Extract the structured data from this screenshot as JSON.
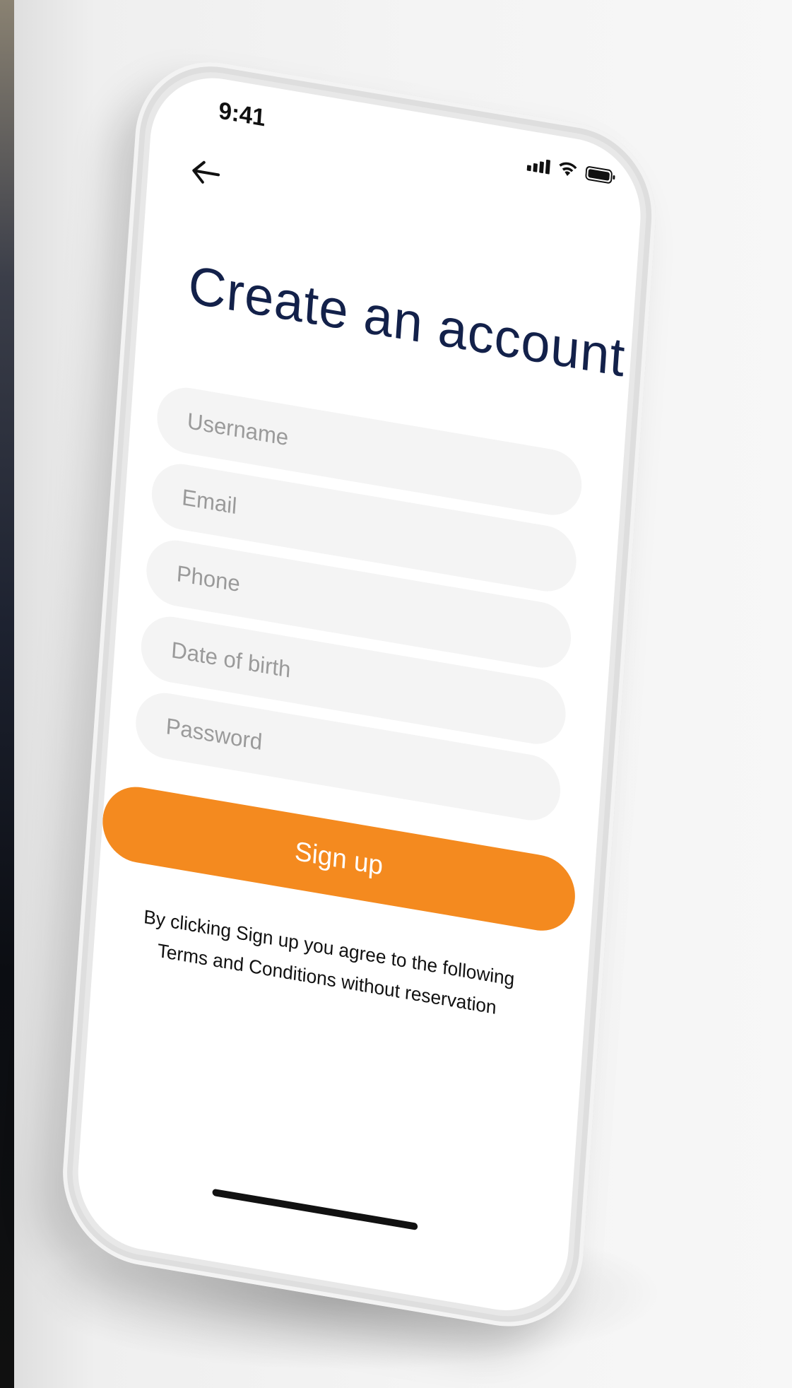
{
  "status_bar": {
    "time": "9:41",
    "icons": [
      "signal-icon",
      "wifi-icon",
      "battery-icon"
    ]
  },
  "header": {
    "back_icon": "arrow-left-icon"
  },
  "title": "Create an account",
  "form": {
    "username_placeholder": "Username",
    "email_placeholder": "Email",
    "phone_placeholder": "Phone",
    "dob_placeholder": "Date of birth",
    "password_placeholder": "Password"
  },
  "signup_label": "Sign up",
  "terms": {
    "line1": "By clicking Sign up you agree to the following",
    "line2": "Terms and Conditions without reservation"
  },
  "colors": {
    "accent": "#f48a1f",
    "title": "#13214a",
    "field_bg": "#f4f4f4",
    "placeholder": "#9a9a9a"
  }
}
